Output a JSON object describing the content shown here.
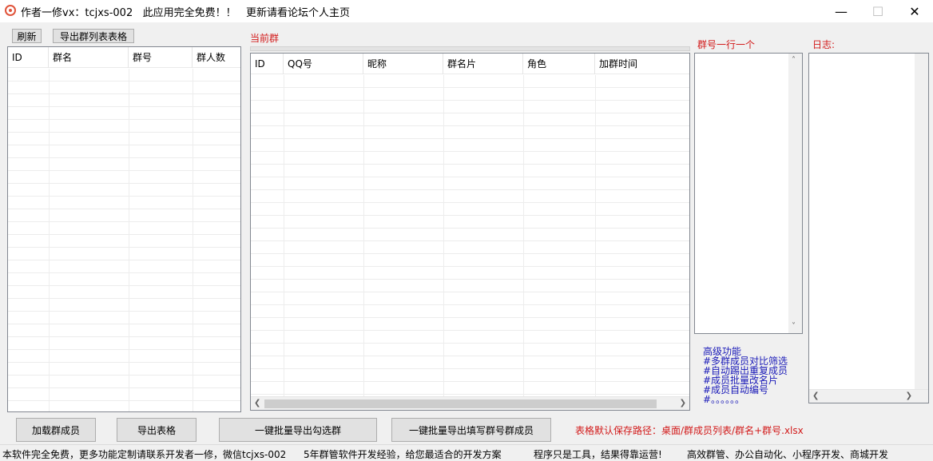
{
  "window": {
    "title": "作者一修vx：tcjxs-002   此应用完全免费！！   更新请看论坛个人主页",
    "minimize": "—",
    "maximize": "☐",
    "close": "✕"
  },
  "toolbar": {
    "refresh_label": "刷新",
    "export_groups_label": "导出群列表表格"
  },
  "group_list": {
    "columns": [
      "ID",
      "群名",
      "群号",
      "群人数"
    ]
  },
  "current_group": {
    "label": "当前群",
    "columns": [
      "ID",
      "QQ号",
      "昵称",
      "群名片",
      "角色",
      "加群时间"
    ]
  },
  "group_numbers": {
    "label": "群号一行一个"
  },
  "log": {
    "label": "日志:"
  },
  "advanced": {
    "lines": [
      "高级功能",
      "#多群成员对比筛选",
      "#自动踢出重复成员",
      "#成员批量改名片",
      "#成员自动编号",
      "#。。。。。。"
    ]
  },
  "bottom_buttons": {
    "load_members": "加载群成员",
    "export_table": "导出表格",
    "batch_export_checked": "一键批量导出勾选群",
    "batch_export_filled": "一键批量导出填写群号群成员"
  },
  "save_path": "表格默认保存路径：桌面/群成员列表/群名+群号.xlsx",
  "status": {
    "item1": "本软件完全免费，更多功能定制请联系开发者一修，微信tcjxs-002",
    "item2": "5年群管软件开发经验，给您最适合的开发方案",
    "item3": "程序只是工具，结果得靠运营!",
    "item4": "高效群管、办公自动化、小程序开发、商城开发"
  },
  "colors": {
    "accent_red": "#d21a1a",
    "feature_blue": "#1a1ab8",
    "window_bg": "#f0f0f0"
  },
  "icons": {
    "app": "app-logo-icon",
    "scroll_left": "chevron-left-icon",
    "scroll_right": "chevron-right-icon",
    "scroll_up": "chevron-up-icon",
    "scroll_down": "chevron-down-icon"
  }
}
